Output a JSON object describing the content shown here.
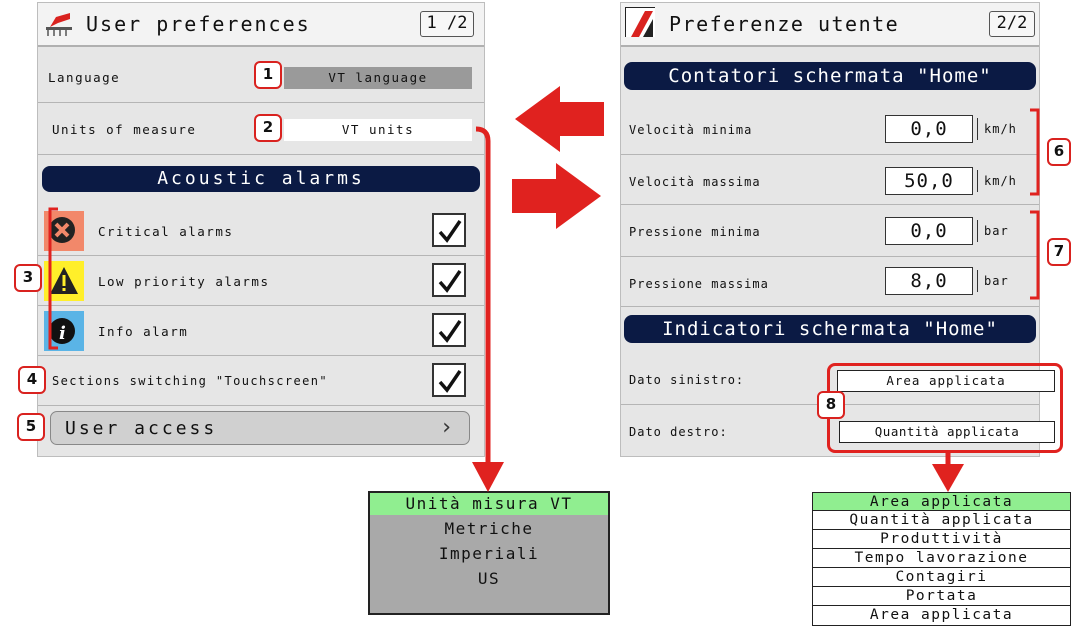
{
  "left_screen": {
    "title": "User preferences",
    "page": "1 /2",
    "rows": {
      "language_label": "Language",
      "language_value": "VT language",
      "units_label": "Units of measure",
      "units_value": "VT units"
    },
    "acoustic_header": "Acoustic alarms",
    "alarms": [
      {
        "label": "Critical alarms",
        "icon": "critical-alarm-icon",
        "checked": true
      },
      {
        "label": "Low priority alarms",
        "icon": "warning-icon",
        "checked": true
      },
      {
        "label": "Info alarm",
        "icon": "info-icon",
        "checked": true
      }
    ],
    "sections_switching_label": "Sections switching \"Touchscreen\"",
    "user_access_label": "User access"
  },
  "right_screen": {
    "title": "Preferenze utente",
    "page": "2/2",
    "counters_header": "Contatori schermata \"Home\"",
    "counters": [
      {
        "label": "Velocità minima",
        "value": "0,0",
        "unit": "km/h"
      },
      {
        "label": "Velocità massima",
        "value": "50,0",
        "unit": "km/h"
      },
      {
        "label": "Pressione minima",
        "value": "0,0",
        "unit": "bar"
      },
      {
        "label": "Pressione massima",
        "value": "8,0",
        "unit": "bar"
      }
    ],
    "indicators_header": "Indicatori schermata \"Home\"",
    "left_data_label": "Dato sinistro:",
    "left_data_value": "Area applicata",
    "right_data_label": "Dato destro:",
    "right_data_value": "Quantità applicata"
  },
  "units_dropdown": [
    "Unità misura VT",
    "Metriche",
    "Imperiali",
    "US"
  ],
  "data_dropdown": [
    "Area applicata",
    "Quantità applicata",
    "Produttività",
    "Tempo lavorazione",
    "Contagiri",
    "Portata",
    "Area applicata"
  ],
  "callouts": [
    "1",
    "2",
    "3",
    "4",
    "5",
    "6",
    "7",
    "8"
  ],
  "colors": {
    "section_bar": "#0b1a44",
    "callout_red": "#e0221f",
    "selected_item": "#90ee90",
    "panel_bg": "#e6e6e6"
  }
}
